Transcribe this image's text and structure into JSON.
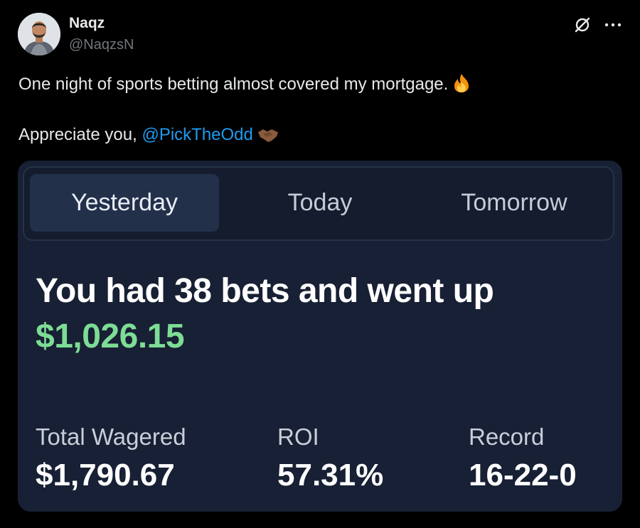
{
  "post": {
    "display_name": "Naqz",
    "handle": "@NaqzsN",
    "text_line1": "One night of sports betting almost covered my mortgage.",
    "text_line1_emoji": "fire-emoji",
    "text_line2": "Appreciate you,",
    "mention": "@PickTheOdd",
    "text_line2_emoji": "handshake-emoji"
  },
  "icons": {
    "grok": "grok-icon",
    "more": "more-icon"
  },
  "card": {
    "tabs": [
      {
        "label": "Yesterday",
        "active": true
      },
      {
        "label": "Today",
        "active": false
      },
      {
        "label": "Tomorrow",
        "active": false
      }
    ],
    "headline": "You had 38 bets and went up",
    "amount": "$1,026.15",
    "stats": [
      {
        "label": "Total Wagered",
        "value": "$1,790.67"
      },
      {
        "label": "ROI",
        "value": "57.31%"
      },
      {
        "label": "Record",
        "value": "16-22-0"
      }
    ]
  },
  "colors": {
    "background": "#000000",
    "mention": "#1d9bf0",
    "card_bg": "#172034",
    "positive_amount": "#7ddc95"
  }
}
